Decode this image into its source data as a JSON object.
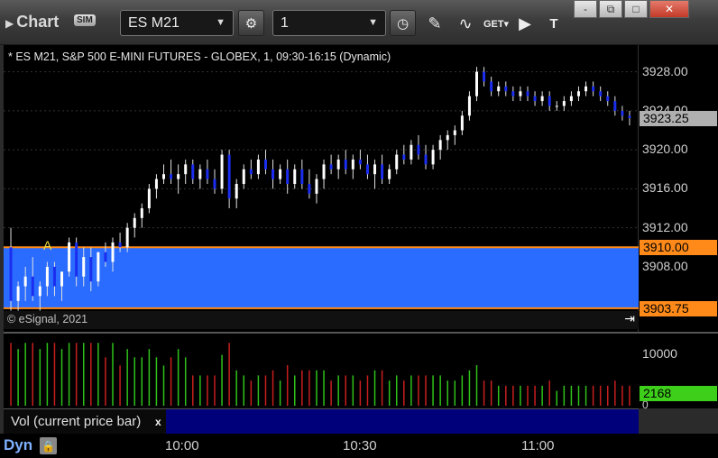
{
  "window": {
    "title": "Chart",
    "sim_badge": "SIM",
    "symbol": "ES M21",
    "interval": "1",
    "min_label": "-",
    "restore_label": "⧉",
    "max_label": "□",
    "close_label": "✕"
  },
  "toolbar_icons": [
    "cycle-icon",
    "clock-icon",
    "pencil-icon",
    "study-icon",
    "get-icon",
    "play-icon",
    "tt-icon"
  ],
  "chart": {
    "title": "* ES M21, S&P 500 E-MINI FUTURES - GLOBEX, 1, 09:30-16:15 (Dynamic)",
    "copyright": "© eSignal, 2021",
    "marker": "A",
    "price_labels": [
      "3928.00",
      "3924.00",
      "3920.00",
      "3916.00",
      "3912.00",
      "3908.00"
    ],
    "last_price": "3923.25",
    "band_high": "3910.00",
    "band_low": "3903.75",
    "colors": {
      "band": "#2a6cff",
      "band_line": "#ff8a1a",
      "up_bar": "#ffffff",
      "down_bar": "#1b2ef0"
    }
  },
  "volume": {
    "label": "Vol (current price bar)",
    "close": "x",
    "axis_labels": [
      "10000",
      "0"
    ],
    "current": "2168",
    "current_color": "#3ecf1a"
  },
  "time_axis": {
    "mode": "Dyn",
    "labels": [
      "10:00",
      "10:30",
      "11:00"
    ]
  },
  "chart_data": {
    "type": "candlestick",
    "y_range": [
      3903,
      3930
    ],
    "candles": [
      [
        3910.0,
        3912.0,
        3903.5,
        3904.5
      ],
      [
        3904.5,
        3906.5,
        3903.5,
        3906.0
      ],
      [
        3906.0,
        3908.0,
        3904.5,
        3907.0
      ],
      [
        3907.0,
        3909.0,
        3904.5,
        3905.0
      ],
      [
        3905.0,
        3906.5,
        3903.5,
        3906.0
      ],
      [
        3906.0,
        3908.5,
        3905.0,
        3908.0
      ],
      [
        3908.0,
        3908.5,
        3905.0,
        3906.0
      ],
      [
        3906.0,
        3907.5,
        3904.5,
        3907.5
      ],
      [
        3907.5,
        3911.0,
        3907.0,
        3910.5
      ],
      [
        3910.5,
        3911.0,
        3906.0,
        3907.0
      ],
      [
        3907.0,
        3910.0,
        3906.0,
        3909.0
      ],
      [
        3909.0,
        3910.0,
        3905.5,
        3906.5
      ],
      [
        3906.5,
        3909.5,
        3906.0,
        3909.5
      ],
      [
        3909.5,
        3910.5,
        3908.0,
        3908.5
      ],
      [
        3908.5,
        3911.0,
        3907.5,
        3910.5
      ],
      [
        3910.5,
        3911.5,
        3909.5,
        3910.0
      ],
      [
        3910.0,
        3912.5,
        3909.5,
        3912.0
      ],
      [
        3912.0,
        3913.5,
        3911.0,
        3913.0
      ],
      [
        3913.0,
        3914.5,
        3912.0,
        3914.0
      ],
      [
        3914.0,
        3916.5,
        3913.5,
        3916.0
      ],
      [
        3916.0,
        3917.5,
        3915.0,
        3917.0
      ],
      [
        3917.0,
        3918.5,
        3916.5,
        3917.5
      ],
      [
        3917.5,
        3919.0,
        3916.5,
        3917.0
      ],
      [
        3917.0,
        3918.5,
        3915.5,
        3917.5
      ],
      [
        3917.5,
        3919.0,
        3916.5,
        3918.5
      ],
      [
        3918.5,
        3919.0,
        3916.5,
        3917.0
      ],
      [
        3917.0,
        3918.5,
        3916.0,
        3918.0
      ],
      [
        3918.0,
        3919.0,
        3916.5,
        3917.0
      ],
      [
        3917.0,
        3918.0,
        3915.5,
        3916.0
      ],
      [
        3916.0,
        3920.0,
        3915.5,
        3919.5
      ],
      [
        3919.5,
        3920.0,
        3914.0,
        3915.0
      ],
      [
        3915.0,
        3917.0,
        3914.0,
        3916.5
      ],
      [
        3916.5,
        3918.5,
        3916.0,
        3918.0
      ],
      [
        3918.0,
        3919.0,
        3917.0,
        3917.5
      ],
      [
        3917.5,
        3919.5,
        3917.0,
        3919.0
      ],
      [
        3919.0,
        3920.0,
        3917.5,
        3918.0
      ],
      [
        3918.0,
        3919.0,
        3916.0,
        3917.0
      ],
      [
        3917.0,
        3918.5,
        3916.5,
        3918.0
      ],
      [
        3918.0,
        3919.0,
        3915.5,
        3916.5
      ],
      [
        3916.5,
        3918.5,
        3916.0,
        3918.0
      ],
      [
        3918.0,
        3919.0,
        3916.0,
        3916.5
      ],
      [
        3916.5,
        3918.0,
        3915.0,
        3915.5
      ],
      [
        3915.5,
        3917.5,
        3914.5,
        3917.0
      ],
      [
        3917.0,
        3919.0,
        3916.0,
        3918.5
      ],
      [
        3918.5,
        3919.5,
        3917.5,
        3918.0
      ],
      [
        3918.0,
        3919.5,
        3917.0,
        3919.0
      ],
      [
        3919.0,
        3920.0,
        3917.5,
        3918.0
      ],
      [
        3918.0,
        3919.5,
        3917.0,
        3919.0
      ],
      [
        3919.0,
        3920.0,
        3918.0,
        3918.5
      ],
      [
        3918.5,
        3919.5,
        3917.0,
        3917.5
      ],
      [
        3917.5,
        3919.0,
        3916.0,
        3918.5
      ],
      [
        3918.5,
        3919.5,
        3916.5,
        3917.0
      ],
      [
        3917.0,
        3918.5,
        3916.5,
        3918.0
      ],
      [
        3918.0,
        3920.0,
        3917.5,
        3919.5
      ],
      [
        3919.5,
        3920.5,
        3918.5,
        3919.0
      ],
      [
        3919.0,
        3921.0,
        3918.5,
        3920.5
      ],
      [
        3920.5,
        3921.5,
        3919.0,
        3919.5
      ],
      [
        3919.5,
        3920.5,
        3918.0,
        3918.5
      ],
      [
        3918.5,
        3920.5,
        3918.0,
        3920.0
      ],
      [
        3920.0,
        3921.5,
        3919.0,
        3921.0
      ],
      [
        3921.0,
        3922.0,
        3920.0,
        3921.5
      ],
      [
        3921.5,
        3922.5,
        3920.5,
        3922.0
      ],
      [
        3922.0,
        3924.0,
        3921.5,
        3923.5
      ],
      [
        3923.5,
        3926.0,
        3923.0,
        3925.5
      ],
      [
        3925.5,
        3928.5,
        3925.0,
        3928.0
      ],
      [
        3928.0,
        3928.5,
        3926.5,
        3927.0
      ],
      [
        3927.0,
        3927.5,
        3925.5,
        3926.0
      ],
      [
        3926.0,
        3927.0,
        3925.5,
        3926.5
      ],
      [
        3926.5,
        3927.0,
        3925.5,
        3926.0
      ],
      [
        3926.0,
        3926.5,
        3925.0,
        3925.5
      ],
      [
        3925.5,
        3926.5,
        3925.0,
        3926.0
      ],
      [
        3926.0,
        3926.5,
        3925.0,
        3925.5
      ],
      [
        3925.5,
        3926.0,
        3924.5,
        3925.0
      ],
      [
        3925.0,
        3926.0,
        3924.5,
        3925.5
      ],
      [
        3925.5,
        3926.0,
        3924.0,
        3924.5
      ],
      [
        3924.5,
        3925.0,
        3924.0,
        3924.5
      ],
      [
        3924.5,
        3925.5,
        3924.0,
        3925.0
      ],
      [
        3925.0,
        3926.0,
        3924.5,
        3925.5
      ],
      [
        3925.5,
        3926.5,
        3925.0,
        3926.0
      ],
      [
        3926.0,
        3927.0,
        3925.5,
        3926.5
      ],
      [
        3926.5,
        3927.0,
        3925.5,
        3926.0
      ],
      [
        3926.0,
        3926.5,
        3925.0,
        3925.5
      ],
      [
        3925.5,
        3926.0,
        3924.5,
        3925.0
      ],
      [
        3925.0,
        3925.5,
        3923.5,
        3924.0
      ],
      [
        3924.0,
        3924.5,
        3923.0,
        3923.5
      ],
      [
        3923.5,
        3924.0,
        3922.5,
        3923.25
      ]
    ]
  }
}
